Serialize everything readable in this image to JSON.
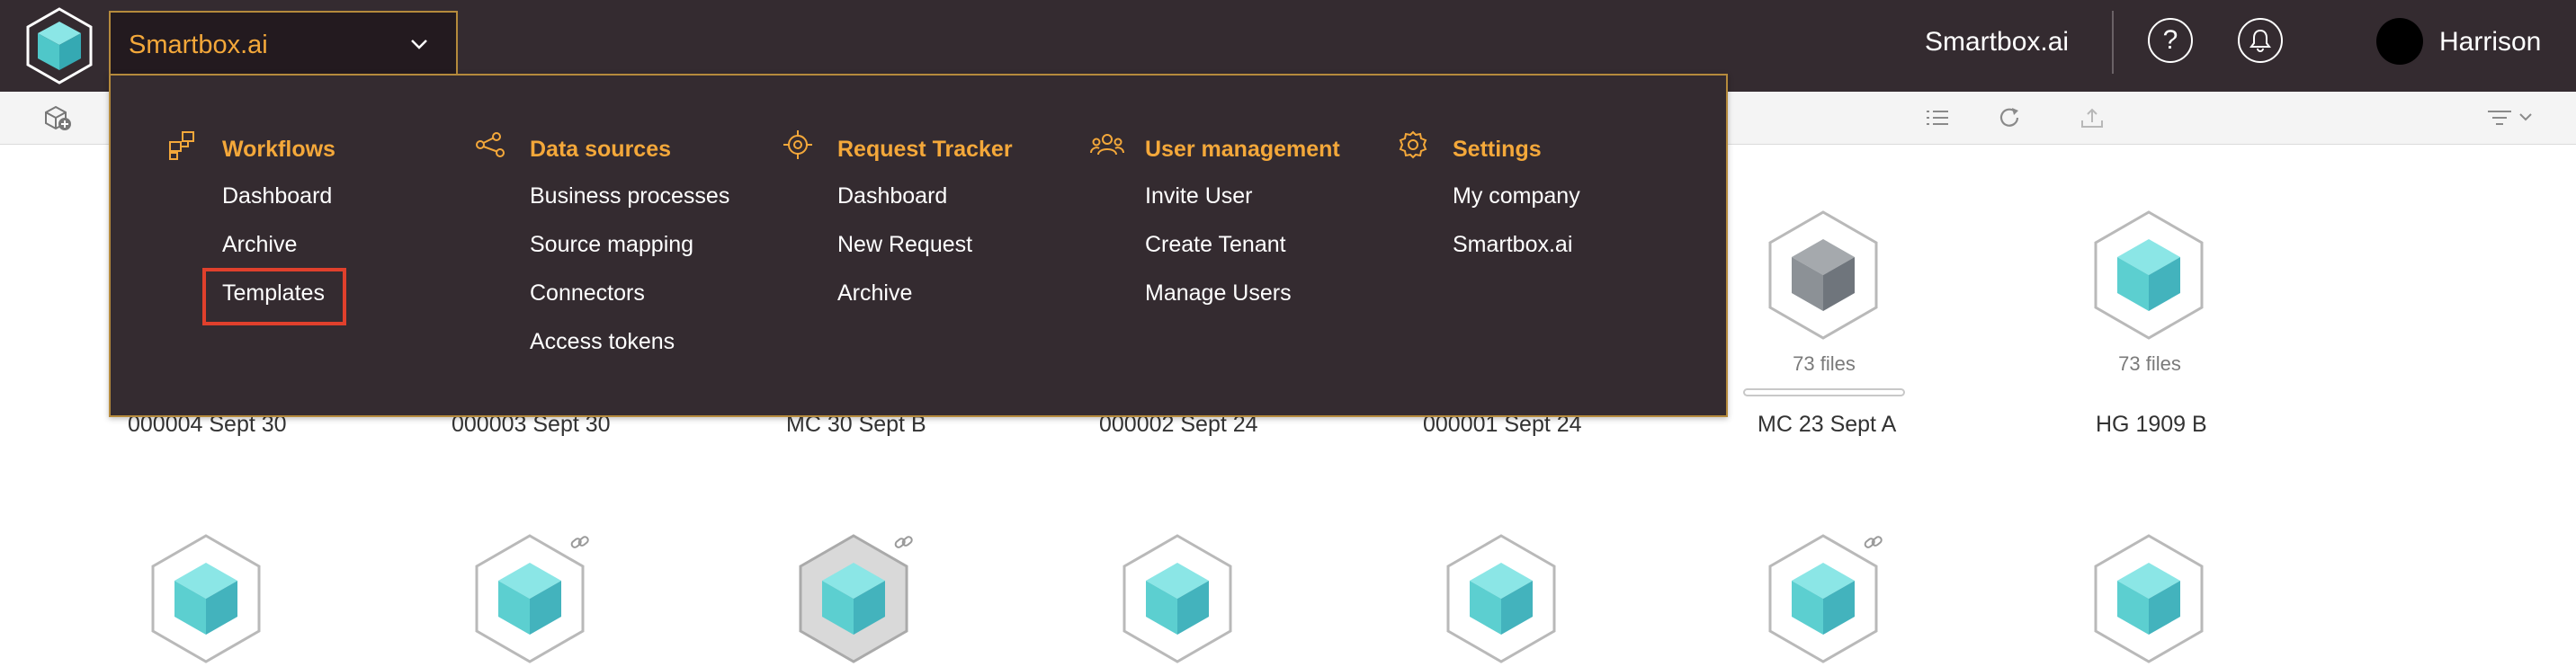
{
  "app": {
    "selected": "Smartbox.ai",
    "brand_title": "Smartbox.ai",
    "user": "Harrison"
  },
  "colors": {
    "topbar": "#342b30",
    "accent": "#f4a83a",
    "highlight": "#e0402c",
    "cube_teal": "#5ccfd0",
    "cube_grey": "#6f757c"
  },
  "icons": {
    "help": "question-icon",
    "notifications": "bell-icon",
    "workflows": "workflow-icon",
    "data_sources": "share-nodes-icon",
    "request_tracker": "target-icon",
    "user_management": "users-icon",
    "settings": "gear-icon"
  },
  "help_glyph": "?",
  "menu": {
    "columns": [
      {
        "title": "Workflows",
        "items": [
          "Dashboard",
          "Archive",
          "Templates"
        ]
      },
      {
        "title": "Data sources",
        "items": [
          "Business processes",
          "Source mapping",
          "Connectors",
          "Access tokens"
        ]
      },
      {
        "title": "Request Tracker",
        "items": [
          "Dashboard",
          "New Request",
          "Archive"
        ]
      },
      {
        "title": "User management",
        "items": [
          "Invite User",
          "Create Tenant",
          "Manage Users"
        ]
      },
      {
        "title": "Settings",
        "items": [
          "My company",
          "Smartbox.ai"
        ]
      }
    ]
  },
  "files": {
    "row1": [
      {
        "name": "000004 Sept 30"
      },
      {
        "name": "000003 Sept 30"
      },
      {
        "name": "MC 30 Sept B"
      },
      {
        "name": "000002 Sept 24"
      },
      {
        "name": "000001 Sept 24"
      },
      {
        "name": "MC 23 Sept A",
        "count": "73 files",
        "style": "grey",
        "progress": 0
      },
      {
        "name": "HG 1909 B",
        "count": "73 files",
        "style": "teal"
      }
    ]
  }
}
